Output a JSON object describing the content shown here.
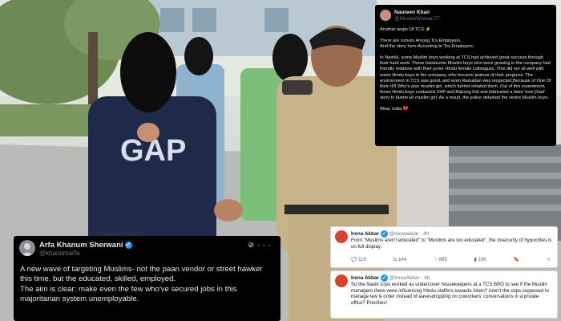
{
  "tweets": {
    "naureen": {
      "name": "Naureen Khan",
      "handle": "@MuslimWoman77",
      "paragraphs": [
        "Another angle Of TCS.⚡",
        "There are rumors Among Tcs Employers.\nAnd the story here According to Tcs Employers.",
        "In Nashik, some Muslim boys working at TCS had achieved great success through their hard work. These handsome Muslim boys who were growing in the company had friendly relations with their junior Hindu female colleagues. This did not sit well with some Hindu boys in the company, who became jealous of their progress. The environment in TCS was good, and even Ramadan was respected,Because of One Of their HR Who's also muslim girl, which further irritated them. Out of this resentment, those Hindu boys contacted VHP and Bajrang Dal and fabricated a false 'love jihad' story to blame Hr muslim girl. As a result, the police detained the senior Muslim boys.",
        "Wow, India.💔"
      ]
    },
    "arfa": {
      "name": "Arfa Khanum Sherwani",
      "handle": "@khanumarfa",
      "body": "A new wave of targeting Muslims- not the paan vendor or street hawker this time, but the educated, skilled, employed.\nThe aim is clear: make even the few who've secured jobs in this majoritarian system unemployable."
    },
    "irena1": {
      "name": "Irena Akbar",
      "handle": "@irenaakbar",
      "time": "· 4h",
      "body": "From \"Muslims aren't educated\" to \"Muslims are too educated\", the insecurity of hypocrites is on full display.",
      "stats": {
        "replies": "119",
        "reposts": "144",
        "likes": "889",
        "views": "10K"
      }
    },
    "irena2": {
      "name": "Irena Akbar",
      "handle": "@IrenaAkbar",
      "time": "· 4h",
      "body": "So the Nasik cops worked as undercover housekeepers at a TCS BPO to see if the Muslim managers there were influencing Hindu staffers towards Islam? Aren't the cops supposed to manage law & order instead of eavesdropping on coworkers' conversations in a private office? Priorities!"
    }
  },
  "photo": {
    "shirt_text": "GAP"
  },
  "colors": {
    "dark_card": "#000000",
    "light_card": "#ffffff",
    "verified": "#1d9bf0",
    "police_uniform": "#c8b28a",
    "navy_shirt": "#1f2a4a"
  }
}
